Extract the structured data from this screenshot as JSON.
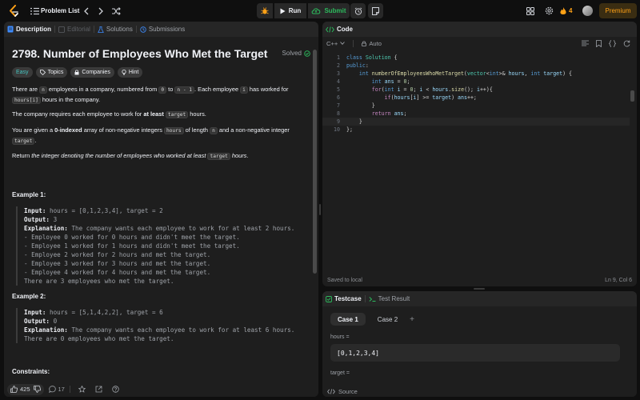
{
  "topbar": {
    "problem_list": "Problem List",
    "run_label": "Run",
    "submit_label": "Submit",
    "streak_count": "4",
    "premium_label": "Premium"
  },
  "left_tabs": {
    "description": "Description",
    "editorial": "Editorial",
    "solutions": "Solutions",
    "submissions": "Submissions"
  },
  "problem": {
    "title": "2798. Number of Employees Who Met the Target",
    "status": "Solved",
    "tags": [
      "Easy",
      "Topics",
      "Companies",
      "Hint"
    ],
    "p1": {
      "a": "There are ",
      "n": "n",
      "b": " employees in a company, numbered from ",
      "zero": "0",
      "c": " to ",
      "nminus": "n - 1",
      "d": ". Each employee ",
      "i": "i",
      "e": " has worked for",
      "hoursi": "hours[i]",
      "f": " hours in the company."
    },
    "p2": {
      "a": "The company requires each employee to work for ",
      "atleast": "at least",
      "target": "target",
      "b": " hours."
    },
    "p3": {
      "a": "You are given a ",
      "zi": "0-indexed",
      "b": " array of non-negative integers ",
      "hours": "hours",
      "c": " of length ",
      "n": "n",
      "d": " and a non-negative integer",
      "target": "target",
      "e": "."
    },
    "p4": {
      "a": "Return ",
      "b": "the integer denoting the number of employees who worked at least ",
      "target": "target",
      "c": " hours",
      "d": "."
    },
    "example1": {
      "title": "Example 1:",
      "input_label": "Input:",
      "input": " hours = [0,1,2,3,4], target = 2",
      "output_label": "Output:",
      "output": " 3",
      "expl_label": "Explanation:",
      "expl": " The company wants each employee to work for at least 2 hours.",
      "lines": [
        "- Employee 0 worked for 0 hours and didn't meet the target.",
        "- Employee 1 worked for 1 hours and didn't meet the target.",
        "- Employee 2 worked for 2 hours and met the target.",
        "- Employee 3 worked for 3 hours and met the target.",
        "- Employee 4 worked for 4 hours and met the target.",
        "There are 3 employees who met the target."
      ]
    },
    "example2": {
      "title": "Example 2:",
      "input_label": "Input:",
      "input": " hours = [5,1,4,2,2], target = 6",
      "output_label": "Output:",
      "output": " 0",
      "expl_label": "Explanation:",
      "expl": " The company wants each employee to work for at least 6 hours.",
      "lines": [
        "There are 0 employees who met the target."
      ]
    },
    "constraints_title": "Constraints:"
  },
  "bottom_bar": {
    "likes": "425",
    "comments": "17"
  },
  "code_panel": {
    "title": "Code",
    "language": "C++",
    "auto_label": "Auto",
    "saved": "Saved to local",
    "cursor": "Ln 9, Col 6",
    "line_numbers": [
      "1",
      "2",
      "3",
      "4",
      "5",
      "6",
      "7",
      "8",
      "9",
      "10"
    ]
  },
  "test_panel": {
    "testcase_tab": "Testcase",
    "result_tab": "Test Result",
    "case1": "Case 1",
    "case2": "Case 2",
    "add": "+",
    "hours_label": "hours =",
    "hours_value": "[0,1,2,3,4]",
    "target_label": "target =",
    "source_label": "Source"
  },
  "colors": {
    "accent_orange": "#ffa116",
    "accent_green": "#2cbb5d",
    "easy": "#46c6c2",
    "panel_bg": "#1e1e1e",
    "page_bg": "#0f0f0f"
  },
  "icons": [
    "logo-icon",
    "list-icon",
    "chevron-left-icon",
    "chevron-right-icon",
    "shuffle-icon",
    "bug-icon",
    "play-icon",
    "cloud-upload-icon",
    "alarm-icon",
    "note-icon",
    "layout-icon",
    "gear-icon",
    "flame-icon",
    "avatar",
    "check-circle-icon",
    "tag-icon",
    "lock-icon",
    "bulb-icon",
    "thumb-up-icon",
    "thumb-down-icon",
    "comment-icon",
    "star-icon",
    "share-icon",
    "help-icon",
    "code-icon",
    "chevron-down-icon",
    "lock-icon",
    "format-icon",
    "bookmark-icon",
    "braces-icon",
    "reset-icon",
    "checkbox-icon",
    "terminal-icon"
  ]
}
